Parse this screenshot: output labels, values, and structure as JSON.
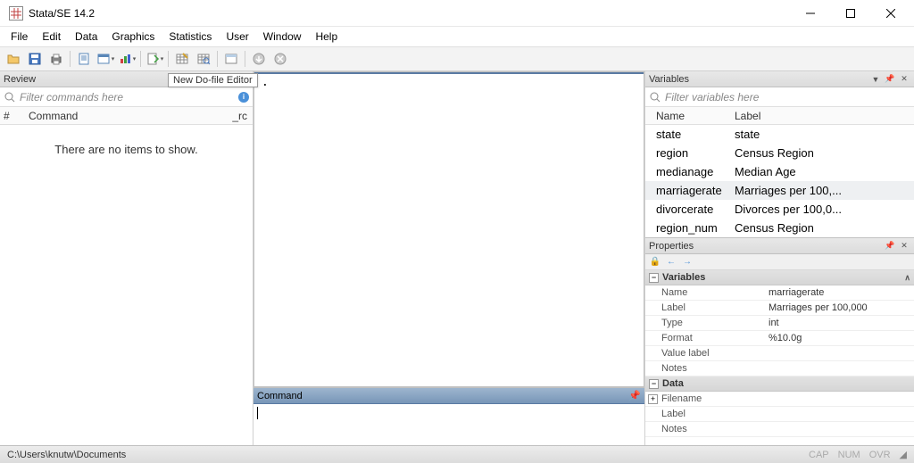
{
  "titlebar": {
    "title": "Stata/SE 14.2"
  },
  "menubar": [
    "File",
    "Edit",
    "Data",
    "Graphics",
    "Statistics",
    "User",
    "Window",
    "Help"
  ],
  "tooltip": "New Do-file Editor",
  "review": {
    "title": "Review",
    "filter_placeholder": "Filter commands here",
    "col_hash": "#",
    "col_cmd": "Command",
    "col_rc": "_rc",
    "empty": "There are no items to show."
  },
  "output": {
    "content": "."
  },
  "command": {
    "title": "Command"
  },
  "variables": {
    "title": "Variables",
    "filter_placeholder": "Filter variables here",
    "col_name": "Name",
    "col_label": "Label",
    "rows": [
      {
        "name": "state",
        "label": "state"
      },
      {
        "name": "region",
        "label": "Census Region"
      },
      {
        "name": "medianage",
        "label": "Median Age"
      },
      {
        "name": "marriagerate",
        "label": "Marriages per 100,..."
      },
      {
        "name": "divorcerate",
        "label": "Divorces per 100,0..."
      },
      {
        "name": "region_num",
        "label": "Census Region"
      }
    ],
    "selected_index": 3
  },
  "properties": {
    "title": "Properties",
    "section_variables": "Variables",
    "section_data": "Data",
    "var_props": [
      {
        "k": "Name",
        "v": "marriagerate"
      },
      {
        "k": "Label",
        "v": "Marriages per 100,000"
      },
      {
        "k": "Type",
        "v": "int"
      },
      {
        "k": "Format",
        "v": "%10.0g"
      },
      {
        "k": "Value label",
        "v": ""
      },
      {
        "k": "Notes",
        "v": ""
      }
    ],
    "data_props": [
      {
        "k": "Filename",
        "v": ""
      },
      {
        "k": "Label",
        "v": ""
      },
      {
        "k": "Notes",
        "v": ""
      }
    ]
  },
  "statusbar": {
    "path": "C:\\Users\\knutw\\Documents",
    "indicators": [
      "CAP",
      "NUM",
      "OVR"
    ]
  }
}
